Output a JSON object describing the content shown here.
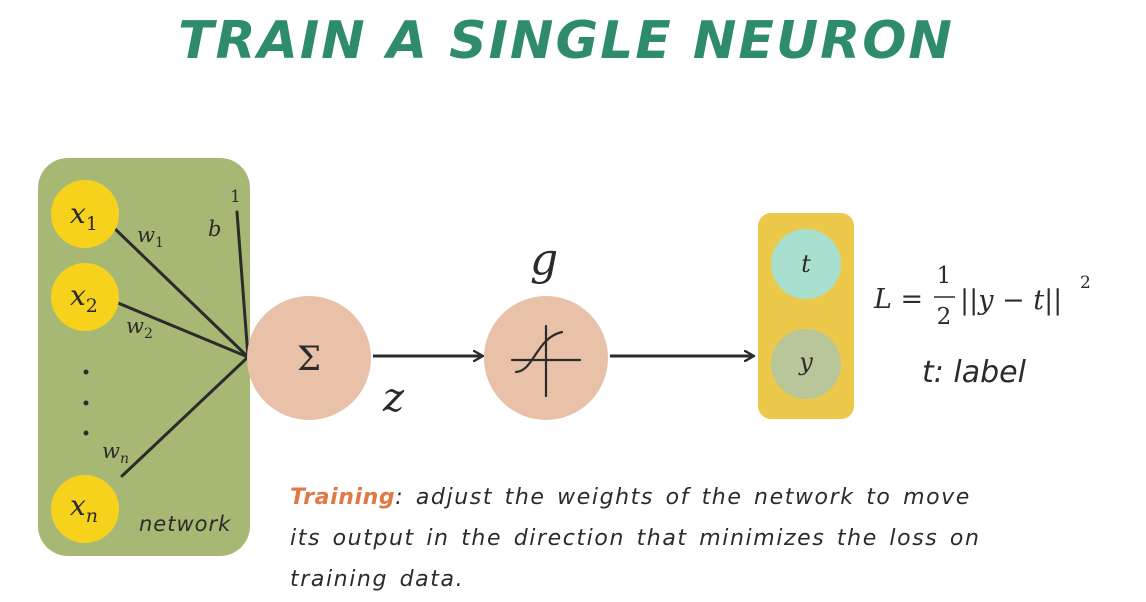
{
  "title": "TRAIN A SINGLE NEURON",
  "network": {
    "caption": "network",
    "inputs": [
      {
        "base": "x",
        "sub": "1"
      },
      {
        "base": "x",
        "sub": "2"
      },
      {
        "base": "x",
        "sub": "n"
      }
    ],
    "weights": [
      {
        "base": "w",
        "sub": "1"
      },
      {
        "base": "w",
        "sub": "2"
      },
      {
        "base": "w",
        "sub": "n"
      }
    ],
    "bias_label": "b",
    "bias_input": "1"
  },
  "sum_node": {
    "symbol": "Σ"
  },
  "z_label": "z",
  "activation": {
    "label": "g"
  },
  "outputs": {
    "t": "t",
    "y": "y"
  },
  "loss": {
    "lhs": "L =",
    "numerator": "1",
    "denominator": "2",
    "body": "||y − t||",
    "exponent": "2"
  },
  "t_note": "t: label",
  "description": {
    "keyword": "Training",
    "text": ": adjust the weights of the network to move its output in the direction that minimizes the loss on training data."
  },
  "colors": {
    "title": "#2e8b6e",
    "network_bg": "#a6b874",
    "input_node": "#f7d21c",
    "neuron": "#e8c1a8",
    "output_bg": "#ecc94a",
    "t_node": "#a8dfcf",
    "y_node": "#b9c699",
    "keyword": "#e07a45"
  }
}
